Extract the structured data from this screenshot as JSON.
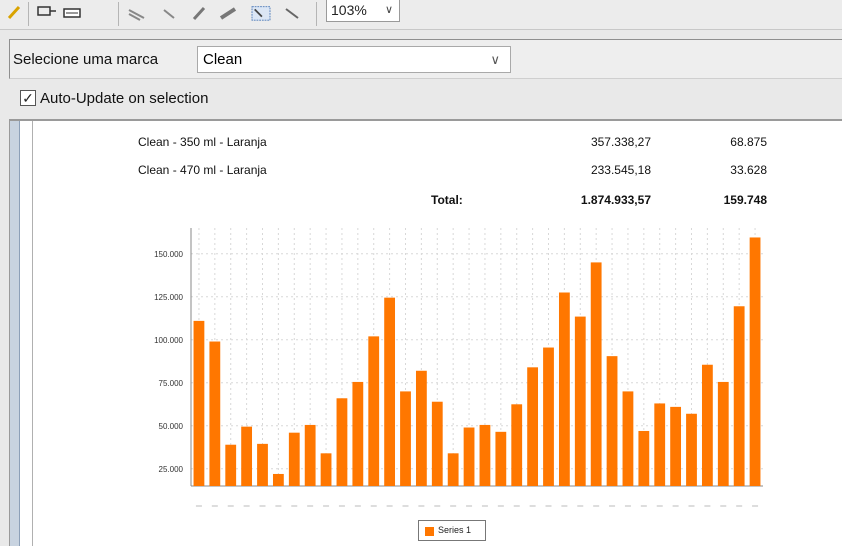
{
  "toolbar": {
    "zoom": "103%",
    "icons": [
      "pencil-icon",
      "insert-icon",
      "printer-icon",
      "tool-icon-1",
      "tool-icon-2",
      "tool-icon-3",
      "tool-icon-4",
      "select-icon",
      "wand-icon"
    ]
  },
  "brand": {
    "label": "Selecione uma marca",
    "selected": "Clean"
  },
  "auto_update": {
    "label": "Auto-Update on selection",
    "checked": true
  },
  "report": {
    "rows": [
      {
        "product": "Clean - 350 ml - Laranja",
        "value": "357.338,27",
        "qty": "68.875"
      },
      {
        "product": "Clean - 470 ml - Laranja",
        "value": "233.545,18",
        "qty": "33.628"
      }
    ],
    "total_label": "Total:",
    "total_value": "1.874.933,57",
    "total_qty": "159.748"
  },
  "colors": {
    "bar": "#ff7700",
    "grid": "#d8d8d8"
  },
  "chart_data": {
    "type": "bar",
    "categories": [
      "",
      "",
      "",
      "",
      "",
      "",
      "",
      "",
      "",
      "",
      "",
      "",
      "",
      "",
      "",
      "",
      "",
      "",
      "",
      "",
      "",
      "",
      "",
      "",
      "",
      "",
      "",
      "",
      "",
      "",
      "",
      "",
      "",
      "",
      "",
      "",
      "",
      ""
    ],
    "series": [
      {
        "name": "Series 1",
        "values": [
          111000,
          99000,
          39000,
          49500,
          39500,
          22000,
          46000,
          50500,
          34000,
          66000,
          75500,
          102000,
          124500,
          70000,
          82000,
          64000,
          34000,
          49000,
          50500,
          46500,
          62500,
          84000,
          95500,
          127500,
          113500,
          145000,
          90500,
          70000,
          47000,
          63000,
          61000,
          57000,
          85500,
          75500,
          119500,
          159500
        ]
      }
    ],
    "ylim": [
      15000,
      165000
    ],
    "yticks": [
      25000,
      50000,
      75000,
      100000,
      125000,
      150000
    ],
    "ytick_labels": [
      "25.000",
      "50.000",
      "75.000",
      "100.000",
      "125.000",
      "150.000"
    ],
    "grid": true,
    "legend": "bottom",
    "title": "",
    "xlabel": "",
    "ylabel": ""
  }
}
